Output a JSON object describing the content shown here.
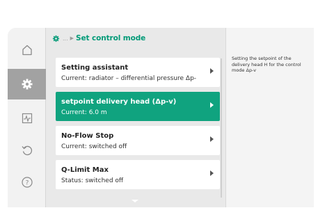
{
  "header": {
    "ellipsis": "...",
    "arrow": "▶",
    "title": "Set control mode",
    "icon": "gear-icon"
  },
  "sidebar": {
    "items": [
      {
        "icon": "home-icon",
        "active": false
      },
      {
        "icon": "gear-icon",
        "active": true
      },
      {
        "icon": "diagnostics-icon",
        "active": false
      },
      {
        "icon": "undo-icon",
        "active": false
      },
      {
        "icon": "help-icon",
        "active": false
      }
    ]
  },
  "menu": {
    "items": [
      {
        "title": "Setting assistant",
        "subtitle": "Current: radiator – differential pressure Δp-",
        "selected": false
      },
      {
        "title": "setpoint delivery head (Δp-v)",
        "subtitle": "Current: 6.0 m",
        "selected": true
      },
      {
        "title": "No-Flow Stop",
        "subtitle": "Current: switched off",
        "selected": false
      },
      {
        "title": "Q-Limit Max",
        "subtitle": "Status: switched off",
        "selected": false
      }
    ]
  },
  "info": {
    "text": "Setting the setpoint of the delivery head H for the control mode Δp-v"
  },
  "colors": {
    "accent": "#10a37f",
    "title_green": "#009a77",
    "sidebar_active": "#a2a2a2"
  }
}
